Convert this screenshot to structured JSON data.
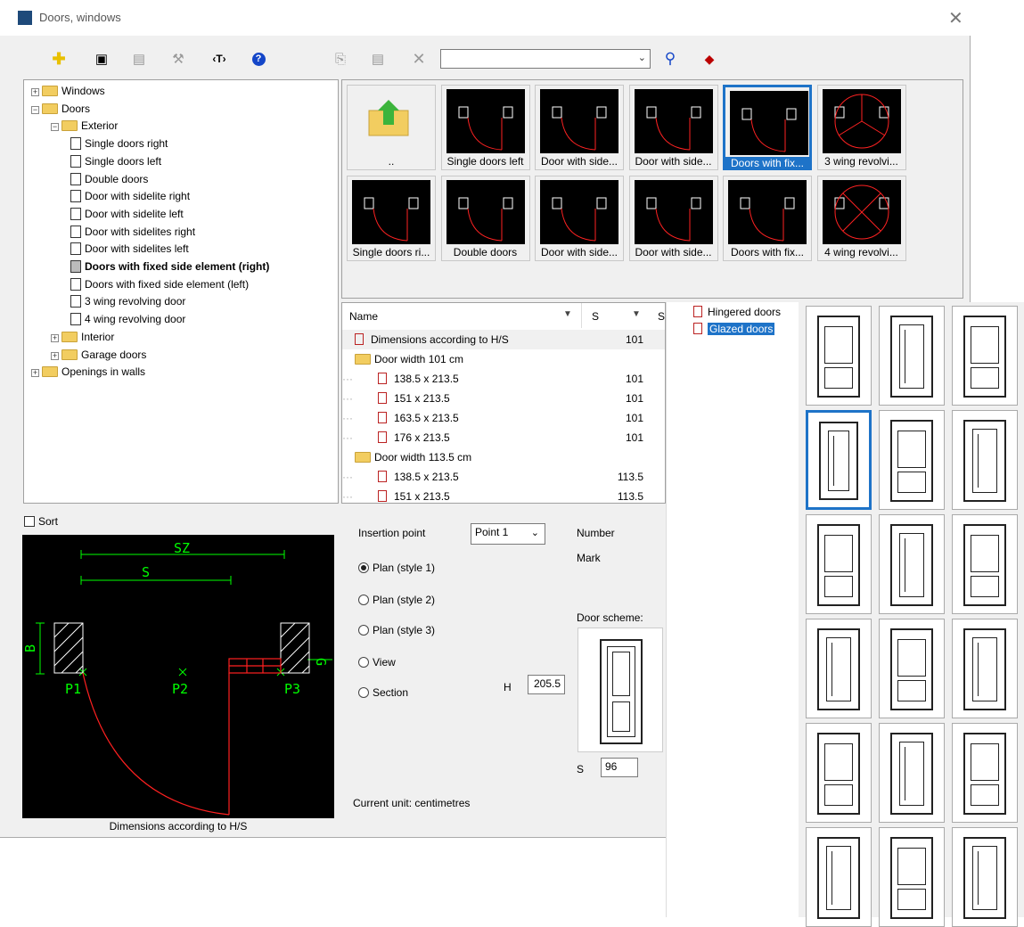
{
  "window": {
    "title": "Doors, windows",
    "close_glyph": "✕"
  },
  "toolbar": {
    "search_value": ""
  },
  "tree": [
    {
      "label": "Windows",
      "level": 0,
      "kind": "folder",
      "pm": "+"
    },
    {
      "label": "Doors",
      "level": 0,
      "kind": "folder",
      "pm": "−"
    },
    {
      "label": "Exterior",
      "level": 1,
      "kind": "folder",
      "pm": "−"
    },
    {
      "label": "Single doors right",
      "level": 2,
      "kind": "doc"
    },
    {
      "label": "Single doors left",
      "level": 2,
      "kind": "doc"
    },
    {
      "label": "Double doors",
      "level": 2,
      "kind": "doc"
    },
    {
      "label": "Door with sidelite right",
      "level": 2,
      "kind": "doc"
    },
    {
      "label": "Door with sidelite left",
      "level": 2,
      "kind": "doc"
    },
    {
      "label": "Door with sidelites right",
      "level": 2,
      "kind": "doc"
    },
    {
      "label": "Door with sidelites left",
      "level": 2,
      "kind": "doc"
    },
    {
      "label": "Doors with fixed side element (right)",
      "level": 2,
      "kind": "doc",
      "selected": true
    },
    {
      "label": "Doors with fixed side element (left)",
      "level": 2,
      "kind": "doc"
    },
    {
      "label": "3 wing revolving door",
      "level": 2,
      "kind": "doc"
    },
    {
      "label": "4 wing revolving door",
      "level": 2,
      "kind": "doc"
    },
    {
      "label": "Interior",
      "level": 1,
      "kind": "folder",
      "pm": "+"
    },
    {
      "label": "Garage doors",
      "level": 1,
      "kind": "folder",
      "pm": "+"
    },
    {
      "label": "Openings in walls",
      "level": 0,
      "kind": "folder",
      "pm": "+"
    }
  ],
  "thumbs": [
    {
      "caption": "..",
      "kind": "up"
    },
    {
      "caption": "Single doors left",
      "kind": "door"
    },
    {
      "caption": "Door with side...",
      "kind": "door"
    },
    {
      "caption": "Door with side...",
      "kind": "door"
    },
    {
      "caption": "Doors with fix...",
      "kind": "door",
      "selected": true
    },
    {
      "caption": "3 wing revolvi...",
      "kind": "rev3"
    },
    {
      "caption": "Single doors ri...",
      "kind": "door"
    },
    {
      "caption": "Double doors",
      "kind": "door"
    },
    {
      "caption": "Door with side...",
      "kind": "door"
    },
    {
      "caption": "Door with side...",
      "kind": "door"
    },
    {
      "caption": "Doors with fix...",
      "kind": "door"
    },
    {
      "caption": "4 wing revolvi...",
      "kind": "rev4"
    }
  ],
  "list": {
    "header_name": "Name",
    "header_s": "S",
    "header_s2": "S",
    "rows": [
      {
        "label": "Dimensions according to H/S",
        "value": "101",
        "kind": "item",
        "indent": 0,
        "highlight": true
      },
      {
        "label": "Door width 101 cm",
        "value": "",
        "kind": "folder",
        "indent": 0
      },
      {
        "label": "138.5 x 213.5",
        "value": "101",
        "kind": "item",
        "indent": 1
      },
      {
        "label": "151 x 213.5",
        "value": "101",
        "kind": "item",
        "indent": 1
      },
      {
        "label": "163.5 x 213.5",
        "value": "101",
        "kind": "item",
        "indent": 1
      },
      {
        "label": "176 x 213.5",
        "value": "101",
        "kind": "item",
        "indent": 1
      },
      {
        "label": "Door width 113.5 cm",
        "value": "",
        "kind": "folder",
        "indent": 0
      },
      {
        "label": "138.5 x 213.5",
        "value": "113.5",
        "kind": "item",
        "indent": 1
      },
      {
        "label": "151 x 213.5",
        "value": "113.5",
        "kind": "item",
        "indent": 1
      }
    ]
  },
  "types": [
    {
      "label": "Hingered doors",
      "selected": false
    },
    {
      "label": "Glazed doors",
      "selected": true
    }
  ],
  "preview": {
    "sort_label": "Sort",
    "caption": "Dimensions according to H/S",
    "labels": {
      "sz": "SZ",
      "s": "S",
      "b": "B",
      "p1": "P1",
      "p2": "P2",
      "p3": "P3",
      "g": "G"
    }
  },
  "options": {
    "insertion_label": "Insertion point",
    "insertion_value": "Point 1",
    "number_label": "Number",
    "mark_label": "Mark",
    "radios": [
      {
        "label": "Plan (style 1)",
        "on": true
      },
      {
        "label": "Plan (style 2)",
        "on": false
      },
      {
        "label": "Plan (style 3)",
        "on": false
      },
      {
        "label": "View",
        "on": false
      },
      {
        "label": "Section",
        "on": false
      }
    ],
    "h_label": "H",
    "h_value": "205.5",
    "scheme_label": "Door scheme:",
    "s_label": "S",
    "s_value": "96",
    "unit_text": "Current unit: centimetres"
  }
}
